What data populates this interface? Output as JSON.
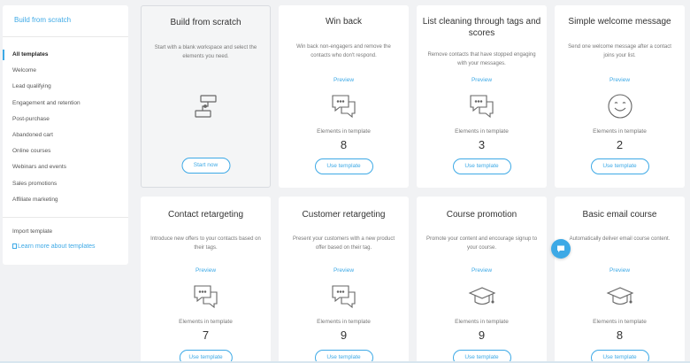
{
  "sidebar": {
    "top_link": "Build from scratch",
    "items": [
      {
        "label": "All templates"
      },
      {
        "label": "Welcome"
      },
      {
        "label": "Lead qualifying"
      },
      {
        "label": "Engagement and retention"
      },
      {
        "label": "Post-purchase"
      },
      {
        "label": "Abandoned cart"
      },
      {
        "label": "Online courses"
      },
      {
        "label": "Webinars and events"
      },
      {
        "label": "Sales promotions"
      },
      {
        "label": "Affiliate marketing"
      }
    ],
    "active_item": "All templates",
    "import_label": "Import template",
    "learn_label": "Learn more about templates"
  },
  "common": {
    "preview_label": "Preview",
    "elements_label": "Elements in template",
    "use_template_label": "Use template"
  },
  "cards": [
    {
      "title": "Build from scratch",
      "desc": "Start with a blank workspace and select the elements you need.",
      "button": "Start now",
      "icon": "workflow-icon"
    },
    {
      "title": "Win back",
      "desc": "Win back non-engagers and remove the contacts who don't respond.",
      "count": "8",
      "icon": "chat-bubbles-icon"
    },
    {
      "title": "List cleaning through tags and scores",
      "desc": "Remove contacts that have stopped engaging with your messages.",
      "count": "3",
      "icon": "chat-bubbles-icon"
    },
    {
      "title": "Simple welcome message",
      "desc": "Send one welcome message after a contact joins your list.",
      "count": "2",
      "icon": "smiley-icon"
    },
    {
      "title": "Contact retargeting",
      "desc": "Introduce new offers to your contacts based on their tags.",
      "count": "7",
      "icon": "chat-bubbles-icon"
    },
    {
      "title": "Customer retargeting",
      "desc": "Present your customers with a new product offer based on their tag.",
      "count": "9",
      "icon": "chat-bubbles-icon"
    },
    {
      "title": "Course promotion",
      "desc": "Promote your content and encourage signup to your course.",
      "count": "9",
      "icon": "graduation-cap-icon"
    },
    {
      "title": "Basic email course",
      "desc": "Automatically deliver email course content.",
      "count": "8",
      "icon": "graduation-cap-icon"
    }
  ],
  "colors": {
    "accent": "#3da9e6",
    "background": "#f1f2f4"
  }
}
